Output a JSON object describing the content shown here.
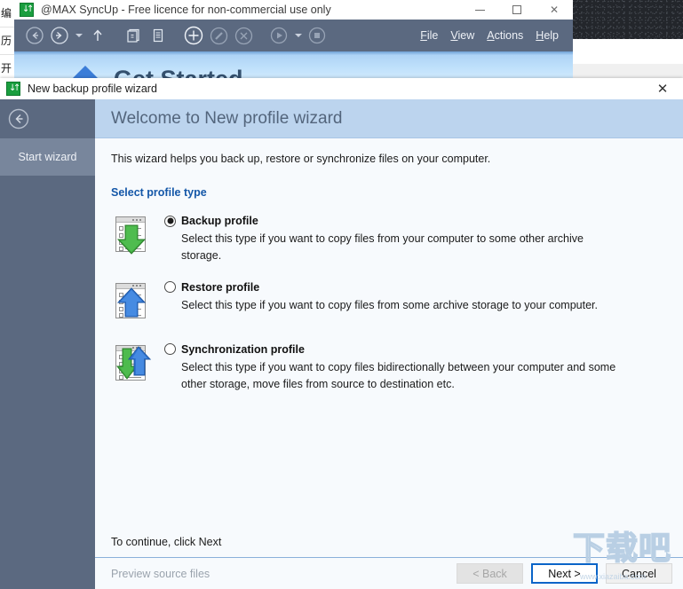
{
  "desktop": {
    "background_strip_chars": [
      "编",
      "历",
      "开"
    ],
    "wallpaper_color": "#23262b"
  },
  "app_window": {
    "icon": "syncup-icon",
    "title": "@MAX SyncUp - Free licence for non-commercial use only",
    "window_controls": {
      "minimize": "minimize-button",
      "maximize": "maximize-button",
      "close": "close-button"
    },
    "toolbar": {
      "items": [
        {
          "name": "back-icon",
          "glyph": "circle-arrow-left"
        },
        {
          "name": "forward-icon",
          "glyph": "circle-arrow-right"
        },
        {
          "name": "forward-dropdown-caret",
          "glyph": "caret-down"
        },
        {
          "name": "up-icon",
          "glyph": "arrow-up"
        },
        {
          "name": "copy-profiles-icon",
          "glyph": "stacked-pages"
        },
        {
          "name": "new-document-icon",
          "glyph": "page"
        },
        {
          "name": "add-icon",
          "glyph": "circle-plus"
        },
        {
          "name": "edit-icon",
          "glyph": "circle-pencil"
        },
        {
          "name": "delete-icon",
          "glyph": "circle-x"
        },
        {
          "name": "run-icon",
          "glyph": "circle-play"
        },
        {
          "name": "run-dropdown-caret",
          "glyph": "caret-down"
        },
        {
          "name": "stop-icon",
          "glyph": "circle-stop"
        }
      ]
    },
    "menu": [
      {
        "accel": "F",
        "rest": "ile"
      },
      {
        "accel": "V",
        "rest": "iew"
      },
      {
        "accel": "A",
        "rest": "ctions"
      },
      {
        "accel": "H",
        "rest": "elp"
      }
    ],
    "banner": {
      "title": "Get Started"
    }
  },
  "dialog": {
    "icon": "syncup-icon",
    "title": "New backup profile wizard",
    "close_label": "✕",
    "header": {
      "title": "Welcome to New profile wizard"
    },
    "rail": {
      "back_icon": "circle-arrow-left-icon",
      "steps": [
        {
          "label": "Start wizard",
          "active": true
        }
      ]
    },
    "intro": "This wizard helps you back up, restore or synchronize files on your computer.",
    "section_label": "Select profile type",
    "options": [
      {
        "id": "backup",
        "icon": "backup-profile-icon",
        "title": "Backup profile",
        "description": "Select this type if you want to copy files from your computer to some other archive storage.",
        "selected": true
      },
      {
        "id": "restore",
        "icon": "restore-profile-icon",
        "title": "Restore profile",
        "description": "Select this type if you want to copy files from some archive storage to your computer.",
        "selected": false
      },
      {
        "id": "sync",
        "icon": "synchronization-profile-icon",
        "title": "Synchronization profile",
        "description": "Select this type if you want to copy files bidirectionally between your computer and some other storage, move files from source to destination etc.",
        "selected": false
      }
    ],
    "continue_note": "To continue, click Next",
    "footer": {
      "preview_link": "Preview source files",
      "back_button": "< Back",
      "next_button": "Next >",
      "cancel_button": "Cancel"
    }
  },
  "watermark": {
    "text": "下载吧",
    "url": "www.xiazaiba.com"
  },
  "colors": {
    "toolbar": "#5b6980",
    "rail": "#5b6980",
    "header": "#bcd4ee",
    "accent_link": "#1457a8",
    "focus_border": "#0a64c8",
    "backup_arrow": "#3faa3f",
    "restore_arrow": "#2f74d0"
  }
}
